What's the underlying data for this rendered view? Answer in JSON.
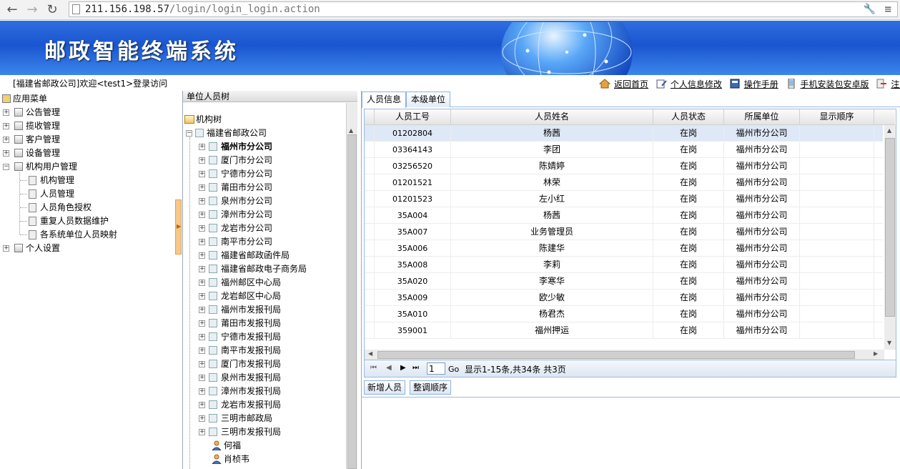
{
  "browser": {
    "url_prefix": "211.156.198.57",
    "url_path": "/login/login_login.action"
  },
  "header": {
    "system_title": "邮政智能终端系统"
  },
  "topbar": {
    "welcome": "[福建省邮政公司]欢迎<test1>登录访问",
    "links": [
      {
        "label": "返回首页",
        "icon": "home-icon"
      },
      {
        "label": "个人信息修改",
        "icon": "edit-profile-icon"
      },
      {
        "label": "操作手册",
        "icon": "manual-icon"
      },
      {
        "label": "手机安装包安卓版",
        "icon": "phone-icon"
      },
      {
        "label": "注销",
        "icon": "logout-icon"
      }
    ]
  },
  "menu": {
    "root": "应用菜单",
    "groups": [
      {
        "label": "公告管理",
        "expanded": false
      },
      {
        "label": "揽收管理",
        "expanded": false
      },
      {
        "label": "客户管理",
        "expanded": false
      },
      {
        "label": "设备管理",
        "expanded": false
      },
      {
        "label": "机构用户管理",
        "expanded": true
      },
      {
        "label": "个人设置",
        "expanded": false
      }
    ],
    "subitems": [
      "机构管理",
      "人员管理",
      "人员角色授权",
      "重复人员数据维护",
      "各系统单位人员映射"
    ]
  },
  "tree": {
    "header": "单位人员树",
    "root": "机构树",
    "company": "福建省邮政公司",
    "branches": [
      "福州市分公司",
      "厦门市分公司",
      "宁德市分公司",
      "莆田市分公司",
      "泉州市分公司",
      "漳州市分公司",
      "龙岩市分公司",
      "南平市分公司",
      "福建省邮政函件局",
      "福建省邮政电子商务局",
      "福州邮区中心局",
      "龙岩邮区中心局",
      "福州市发报刊局",
      "莆田市发报刊局",
      "宁德市发报刊局",
      "南平市发报刊局",
      "厦门市发报刊局",
      "泉州市发报刊局",
      "漳州市发报刊局",
      "龙岩市发报刊局",
      "三明市邮政局",
      "三明市发报刊局"
    ],
    "selected_branch": "福州市分公司",
    "people": [
      "何福",
      "肖桢韦"
    ]
  },
  "main": {
    "tabs": [
      {
        "label": "人员信息",
        "active": true
      },
      {
        "label": "本级单位",
        "active": false
      }
    ],
    "columns": [
      "人员工号",
      "人员姓名",
      "人员状态",
      "所属单位",
      "显示顺序"
    ],
    "rows": [
      [
        "01202804",
        "杨茜",
        "在岗",
        "福州市分公司",
        ""
      ],
      [
        "03364143",
        "李团",
        "在岗",
        "福州市分公司",
        ""
      ],
      [
        "03256520",
        "陈婧婷",
        "在岗",
        "福州市分公司",
        ""
      ],
      [
        "01201521",
        "林荣",
        "在岗",
        "福州市分公司",
        ""
      ],
      [
        "01201523",
        "左小红",
        "在岗",
        "福州市分公司",
        ""
      ],
      [
        "35A004",
        "杨茜",
        "在岗",
        "福州市分公司",
        ""
      ],
      [
        "35A007",
        "业务管理员",
        "在岗",
        "福州市分公司",
        ""
      ],
      [
        "35A006",
        "陈建华",
        "在岗",
        "福州市分公司",
        ""
      ],
      [
        "35A008",
        "李莉",
        "在岗",
        "福州市分公司",
        ""
      ],
      [
        "35A020",
        "李寒华",
        "在岗",
        "福州市分公司",
        ""
      ],
      [
        "35A009",
        "欧少敏",
        "在岗",
        "福州市分公司",
        ""
      ],
      [
        "35A010",
        "杨君杰",
        "在岗",
        "福州市分公司",
        ""
      ],
      [
        "359001",
        "福州押运",
        "在岗",
        "福州市分公司",
        ""
      ]
    ],
    "pager": {
      "page": "1",
      "go": "Go",
      "info": "显示1-15条,共34条   共3页"
    },
    "buttons": {
      "add": "新增人员",
      "reorder": "整调顺序"
    }
  }
}
